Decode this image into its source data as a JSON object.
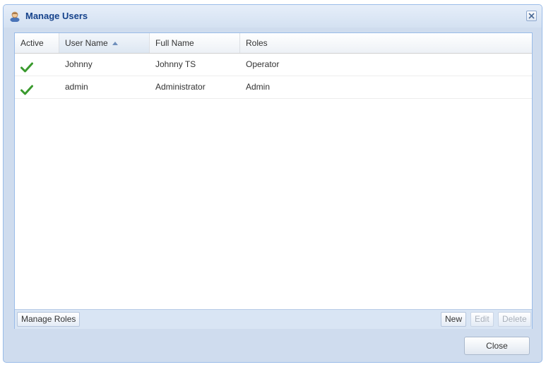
{
  "window": {
    "title": "Manage Users",
    "icon": "user-icon",
    "close_icon": "close-icon"
  },
  "grid": {
    "columns": [
      {
        "label": "Active"
      },
      {
        "label": "User Name",
        "sorted": "ascending"
      },
      {
        "label": "Full Name"
      },
      {
        "label": "Roles"
      }
    ],
    "rows": [
      {
        "active": true,
        "user_name": "Johnny",
        "full_name": "Johnny TS",
        "roles": "Operator"
      },
      {
        "active": true,
        "user_name": "admin",
        "full_name": "Administrator",
        "roles": "Admin"
      }
    ]
  },
  "toolbar": {
    "manage_roles_label": "Manage Roles",
    "new_label": "New",
    "edit_label": "Edit",
    "delete_label": "Delete",
    "edit_enabled": false,
    "delete_enabled": false
  },
  "footer": {
    "close_label": "Close"
  },
  "colors": {
    "title_text": "#15428b",
    "check_green": "#3a9a2e",
    "frame_blue": "#cfdcee"
  }
}
